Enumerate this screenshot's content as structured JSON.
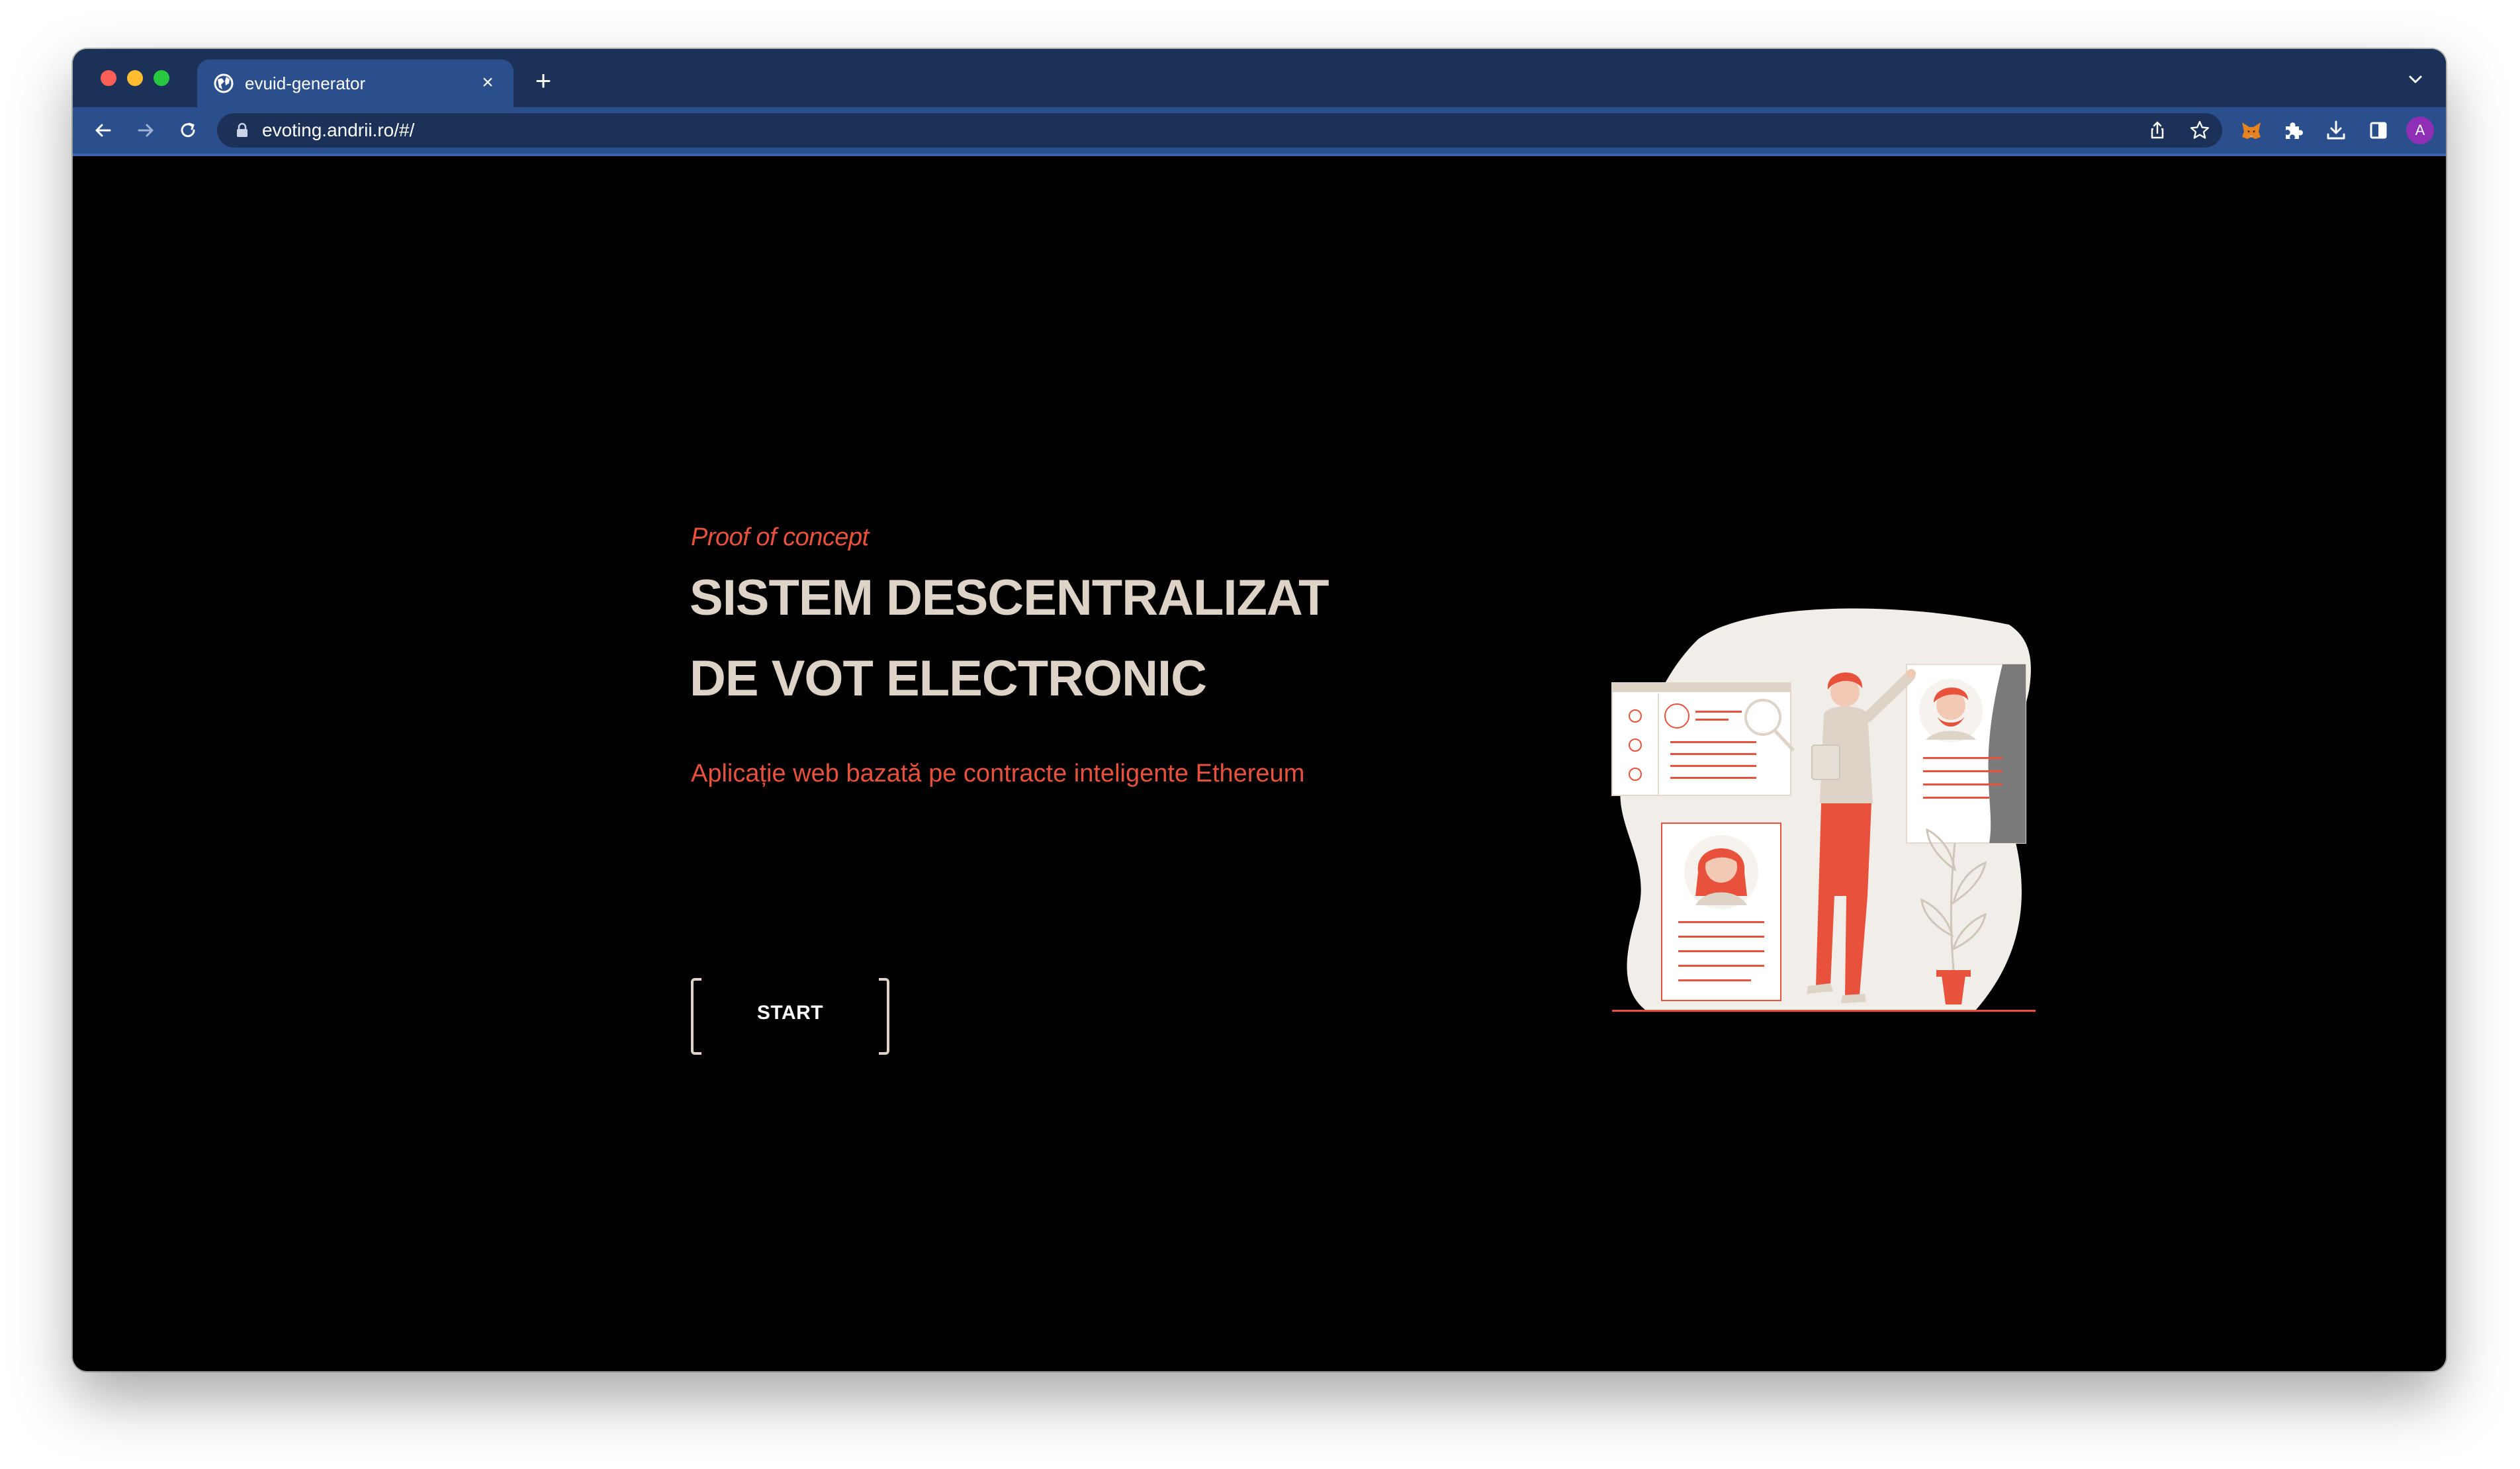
{
  "browser": {
    "tab": {
      "title": "evuid-generator",
      "close_symbol": "×"
    },
    "new_tab_symbol": "+",
    "address": {
      "url": "evoting.andrii.ro/#/"
    },
    "profile_initial": "A"
  },
  "hero": {
    "kicker": "Proof of concept",
    "headline_line1": "SISTEM DESCENTRALIZAT",
    "headline_line2": "DE VOT ELECTRONIC",
    "subtitle": "Aplicație web bazată pe contracte inteligente Ethereum",
    "start_label": "START"
  },
  "colors": {
    "accent": "#e8523c",
    "headline": "#ddd3c6",
    "page_background": "#000000",
    "browser_frame": "#1b3157",
    "browser_toolbar": "#2a4f8c"
  }
}
